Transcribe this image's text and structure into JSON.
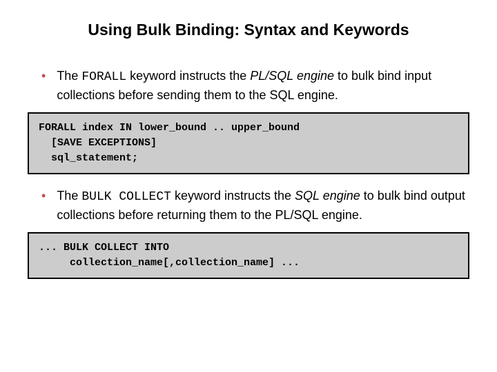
{
  "title": "Using Bulk Binding: Syntax and Keywords",
  "bullets": [
    {
      "pre": "The ",
      "kw": "FORALL",
      "mid": " keyword instructs the ",
      "em": "PL/SQL engine",
      "post": " to bulk bind input collections before sending them to the SQL engine."
    },
    {
      "pre": "The ",
      "kw": "BULK COLLECT",
      "mid": " keyword instructs the ",
      "em": "SQL engine",
      "post": " to bulk bind output collections before returning them to the PL/SQL engine."
    }
  ],
  "code": [
    "FORALL index IN lower_bound .. upper_bound\n  [SAVE EXCEPTIONS]\n  sql_statement;",
    "... BULK COLLECT INTO\n     collection_name[,collection_name] ..."
  ]
}
